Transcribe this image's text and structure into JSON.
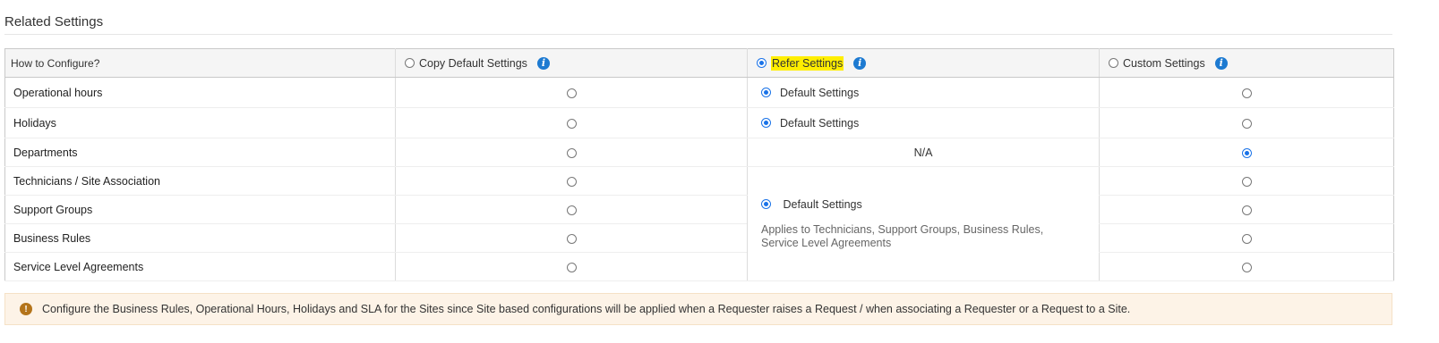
{
  "section": {
    "title": "Related Settings"
  },
  "header": {
    "how_label": "How to Configure?",
    "options": [
      {
        "label": "Copy Default Settings",
        "selected": false,
        "highlighted": false,
        "icon": "info-icon"
      },
      {
        "label": "Refer Settings",
        "selected": true,
        "highlighted": true,
        "icon": "info-icon"
      },
      {
        "label": "Custom Settings",
        "selected": false,
        "highlighted": false,
        "icon": "info-icon"
      }
    ]
  },
  "rows": [
    {
      "label": "Operational hours",
      "copy": false,
      "refer": "Default Settings",
      "custom": false
    },
    {
      "label": "Holidays",
      "copy": false,
      "refer": "Default Settings",
      "custom": false
    },
    {
      "label": "Departments",
      "copy": false,
      "refer": "N/A",
      "custom": true
    },
    {
      "label": "Technicians / Site Association",
      "copy": false,
      "custom": false
    },
    {
      "label": "Support Groups",
      "copy": false,
      "custom": false
    },
    {
      "label": "Business Rules",
      "copy": false,
      "custom": false
    },
    {
      "label": "Service Level Agreements",
      "copy": false,
      "custom": false
    }
  ],
  "merged_refer": {
    "label": "Default Settings",
    "applies_line1": "Applies to Technicians, Support Groups, Business Rules,",
    "applies_line2": "Service Level Agreements"
  },
  "notice": {
    "icon": "exclamation-icon",
    "text": "Configure the Business Rules, Operational Hours, Holidays and SLA for the Sites since Site based configurations will be applied when a Requester raises a Request / when associating a Requester or a Request to a Site."
  },
  "colors": {
    "accent": "#1a73e8",
    "highlight": "#ffee00",
    "info": "#1d7ad1",
    "notice_bg": "#fdf3e7"
  }
}
